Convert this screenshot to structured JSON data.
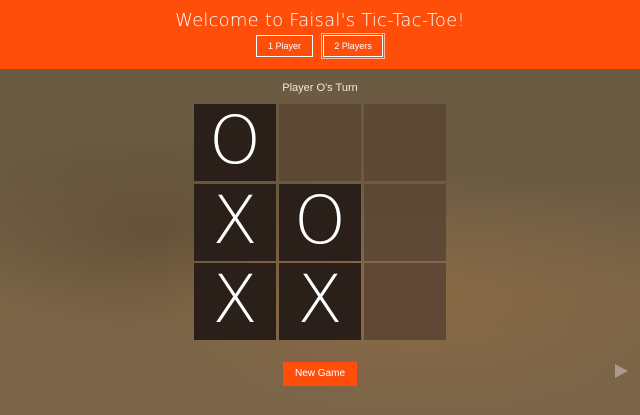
{
  "header": {
    "title": "Welcome to Faisal's Tic-Tac-Toe!",
    "background_color": "#ff4d0a",
    "mode_buttons": [
      {
        "label": "1 Player",
        "selected": false
      },
      {
        "label": "2 Players",
        "selected": true
      }
    ]
  },
  "status": {
    "turn_text": "Player O's Turn"
  },
  "board": {
    "rows": [
      [
        "O",
        "",
        ""
      ],
      [
        "X",
        "O",
        ""
      ],
      [
        "X",
        "X",
        ""
      ]
    ],
    "filled_cell_color": "#2a2019",
    "empty_cell_color": "#5b4634"
  },
  "actions": {
    "new_game_label": "New Game"
  }
}
